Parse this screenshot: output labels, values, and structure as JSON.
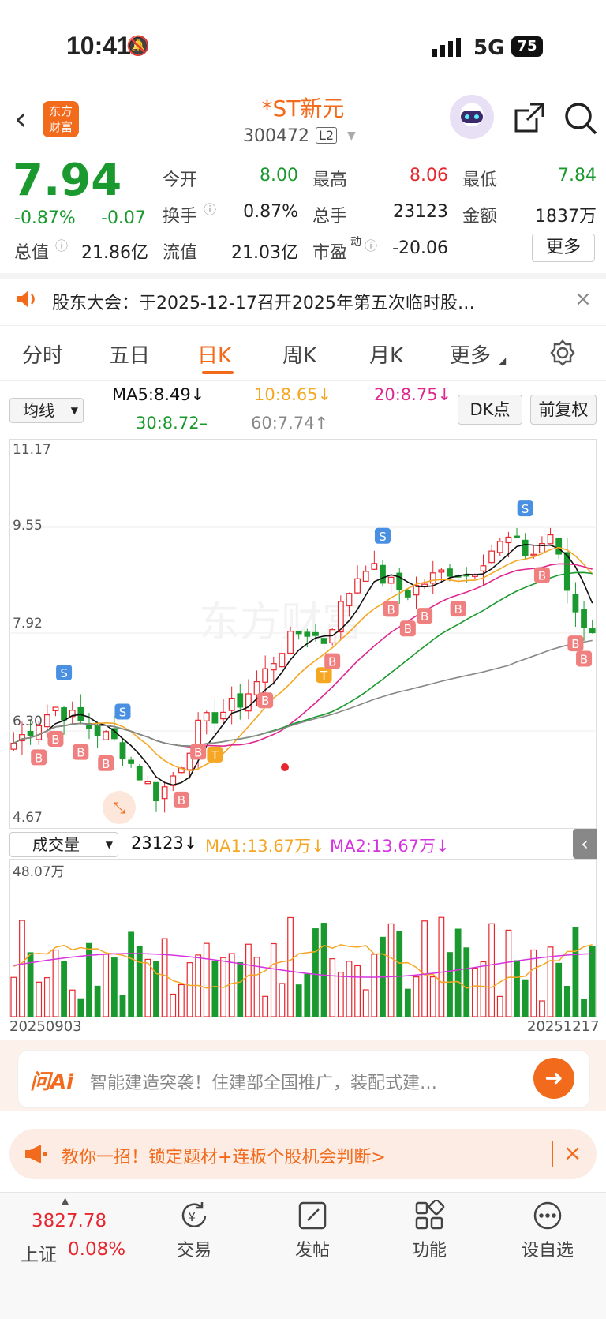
{
  "status_bar": {
    "time": "10:41",
    "network": "5G",
    "battery": "75"
  },
  "header": {
    "name": "*ST新元",
    "code": "300472",
    "level": "L2"
  },
  "quote": {
    "price": "7.94",
    "change_pct": "-0.87%",
    "change": "-0.07",
    "open_label": "今开",
    "open": "8.00",
    "high_label": "最高",
    "high": "8.06",
    "low_label": "最低",
    "low": "7.84",
    "turnover_label": "换手",
    "turnover": "0.87%",
    "volume_label": "总手",
    "volume": "23123",
    "amount_label": "金额",
    "amount": "1837万",
    "mktcap_label": "总值",
    "mktcap": "21.86亿",
    "float_label": "流值",
    "float": "21.03亿",
    "pe_label": "市盈",
    "pe_sup": "动",
    "pe": "-20.06",
    "more": "更多"
  },
  "notice": {
    "text": "股东大会：于2025-12-17召开2025年第五次临时股…"
  },
  "tabs": [
    "分时",
    "五日",
    "日K",
    "周K",
    "月K",
    "更多"
  ],
  "active_tab": "日K",
  "ma": {
    "selector": "均线",
    "ma5": "MA5:8.49↓",
    "ma10": "10:8.65↓",
    "ma20": "20:8.75↓",
    "ma30": "30:8.72–",
    "ma60": "60:7.74↑",
    "dk": "DK点",
    "adjust": "前复权"
  },
  "colors": {
    "up": "#e8262d",
    "down": "#1a9a2e",
    "ma5": "#111111",
    "ma10": "#f5a623",
    "ma20": "#e0268f",
    "ma30": "#1a9a2e",
    "ma60": "#888888",
    "accent": "#f26a1b"
  },
  "chart_data": [
    {
      "type": "candlestick",
      "y_ticks": [
        "11.17",
        "9.55",
        "7.92",
        "6.30",
        "4.67"
      ],
      "ylim": [
        4.67,
        11.17
      ],
      "signals": [
        "S",
        "T",
        "B"
      ]
    },
    {
      "type": "bar",
      "selector": "成交量",
      "volume": "23123↓",
      "ma1": "MA1:13.67万↓",
      "ma2": "MA2:13.67万↓",
      "max_label": "48.07万",
      "x_start": "20250903",
      "x_end": "20251217"
    }
  ],
  "ai_bar": {
    "logo": "问Ai",
    "text": "智能建造突袭！住建部全国推广，装配式建…"
  },
  "promo": {
    "text": "教你一招！锁定题材+连板个股机会判断>"
  },
  "bottom_nav": {
    "index_value": "3827.78",
    "index_name": "上证",
    "index_change": "0.08%",
    "items": [
      "交易",
      "发帖",
      "功能",
      "设自选"
    ]
  }
}
